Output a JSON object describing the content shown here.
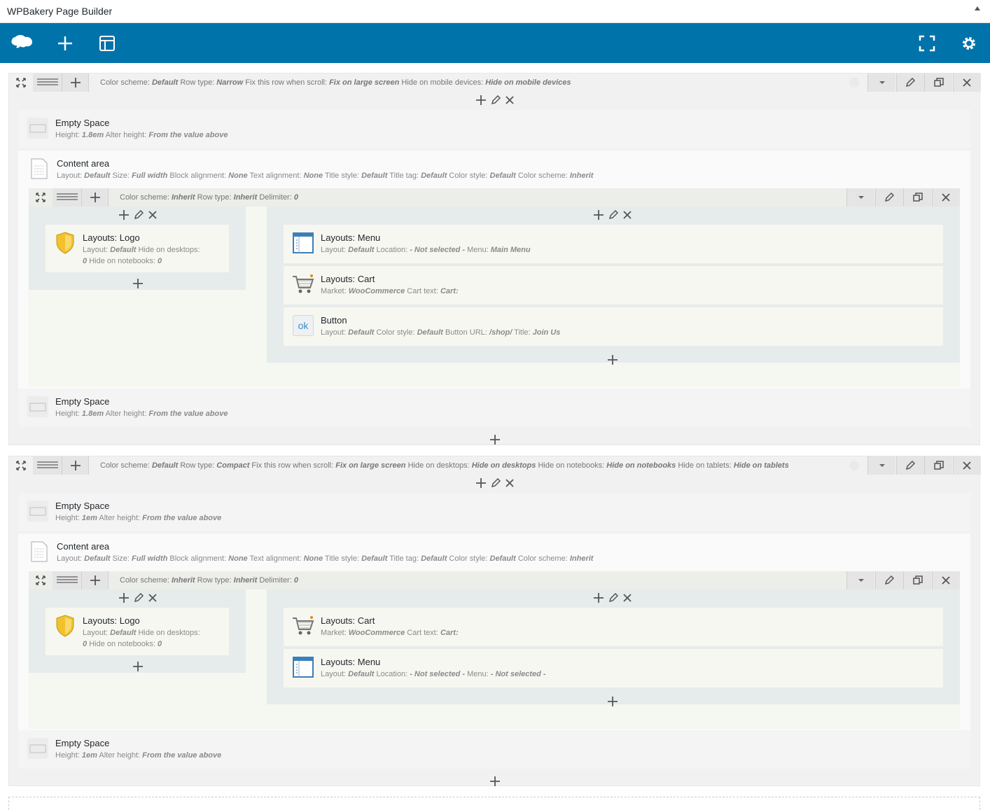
{
  "header": {
    "title": "WPBakery Page Builder"
  },
  "toolbar": {
    "logo_icon": "wpbakery-cloud-icon",
    "add_icon": "plus-icon",
    "templates_icon": "templates-icon",
    "fullscreen_icon": "fullscreen-icon",
    "settings_icon": "gear-icon"
  },
  "rows": [
    {
      "params": [
        {
          "k": "Color scheme:",
          "v": "Default"
        },
        {
          "k": "Row type:",
          "v": "Narrow"
        },
        {
          "k": "Fix this row when scroll:",
          "v": "Fix on large screen"
        },
        {
          "k": "Hide on mobile devices:",
          "v": "Hide on mobile devices"
        }
      ],
      "top_space": {
        "name": "Empty Space",
        "desc": [
          {
            "k": "Height:",
            "v": "1.8em"
          },
          {
            "k": "Alter height:",
            "v": "From the value above"
          }
        ]
      },
      "content": {
        "name": "Content area",
        "desc": [
          {
            "k": "Layout:",
            "v": "Default"
          },
          {
            "k": "Size:",
            "v": "Full width"
          },
          {
            "k": "Block alignment:",
            "v": "None"
          },
          {
            "k": "Text alignment:",
            "v": "None"
          },
          {
            "k": "Title style:",
            "v": "Default"
          },
          {
            "k": "Title tag:",
            "v": "Default"
          },
          {
            "k": "Color style:",
            "v": "Default"
          },
          {
            "k": "Color scheme:",
            "v": "Inherit"
          }
        ]
      },
      "inner_params": [
        {
          "k": "Color scheme:",
          "v": "Inherit"
        },
        {
          "k": "Row type:",
          "v": "Inherit"
        },
        {
          "k": "Delimiter:",
          "v": "0"
        }
      ],
      "logo": {
        "name": "Layouts: Logo",
        "line1": [
          {
            "k": "Layout:",
            "v": "Default"
          },
          {
            "k": "Hide on desktops:",
            "v": ""
          }
        ],
        "line2": [
          {
            "k": "",
            "v": "0"
          },
          {
            "k": "Hide on notebooks:",
            "v": "0"
          }
        ]
      },
      "right": [
        {
          "type": "menu",
          "name": "Layouts: Menu",
          "desc": [
            {
              "k": "Layout:",
              "v": "Default"
            },
            {
              "k": "Location:",
              "v": "- Not selected -"
            },
            {
              "k": "Menu:",
              "v": "Main Menu"
            }
          ]
        },
        {
          "type": "cart",
          "name": "Layouts: Cart",
          "desc": [
            {
              "k": "Market:",
              "v": "WooCommerce"
            },
            {
              "k": "Cart text:",
              "v": "Cart:"
            }
          ]
        },
        {
          "type": "button",
          "name": "Button",
          "desc": [
            {
              "k": "Layout:",
              "v": "Default"
            },
            {
              "k": "Color style:",
              "v": "Default"
            },
            {
              "k": "Button URL:",
              "v": "/shop/"
            },
            {
              "k": "Title:",
              "v": "Join Us"
            }
          ]
        }
      ],
      "bottom_space": {
        "name": "Empty Space",
        "desc": [
          {
            "k": "Height:",
            "v": "1.8em"
          },
          {
            "k": "Alter height:",
            "v": "From the value above"
          }
        ]
      }
    },
    {
      "params": [
        {
          "k": "Color scheme:",
          "v": "Default"
        },
        {
          "k": "Row type:",
          "v": "Compact"
        },
        {
          "k": "Fix this row when scroll:",
          "v": "Fix on large screen"
        },
        {
          "k": "Hide on desktops:",
          "v": "Hide on desktops"
        },
        {
          "k": "Hide on notebooks:",
          "v": "Hide on notebooks"
        },
        {
          "k": "Hide on tablets:",
          "v": "Hide on tablets"
        }
      ],
      "top_space": {
        "name": "Empty Space",
        "desc": [
          {
            "k": "Height:",
            "v": "1em"
          },
          {
            "k": "Alter height:",
            "v": "From the value above"
          }
        ]
      },
      "content": {
        "name": "Content area",
        "desc": [
          {
            "k": "Layout:",
            "v": "Default"
          },
          {
            "k": "Size:",
            "v": "Full width"
          },
          {
            "k": "Block alignment:",
            "v": "None"
          },
          {
            "k": "Text alignment:",
            "v": "None"
          },
          {
            "k": "Title style:",
            "v": "Default"
          },
          {
            "k": "Title tag:",
            "v": "Default"
          },
          {
            "k": "Color style:",
            "v": "Default"
          },
          {
            "k": "Color scheme:",
            "v": "Inherit"
          }
        ]
      },
      "inner_params": [
        {
          "k": "Color scheme:",
          "v": "Inherit"
        },
        {
          "k": "Row type:",
          "v": "Inherit"
        },
        {
          "k": "Delimiter:",
          "v": "0"
        }
      ],
      "logo": {
        "name": "Layouts: Logo",
        "line1": [
          {
            "k": "Layout:",
            "v": "Default"
          },
          {
            "k": "Hide on desktops:",
            "v": ""
          }
        ],
        "line2": [
          {
            "k": "",
            "v": "0"
          },
          {
            "k": "Hide on notebooks:",
            "v": "0"
          }
        ]
      },
      "right": [
        {
          "type": "cart",
          "name": "Layouts: Cart",
          "desc": [
            {
              "k": "Market:",
              "v": "WooCommerce"
            },
            {
              "k": "Cart text:",
              "v": "Cart:"
            }
          ]
        },
        {
          "type": "menu",
          "name": "Layouts: Menu",
          "desc": [
            {
              "k": "Layout:",
              "v": "Default"
            },
            {
              "k": "Location:",
              "v": "- Not selected -"
            },
            {
              "k": "Menu:",
              "v": "- Not selected -"
            }
          ]
        }
      ],
      "bottom_space": {
        "name": "Empty Space",
        "desc": [
          {
            "k": "Height:",
            "v": "1em"
          },
          {
            "k": "Alter height:",
            "v": "From the value above"
          }
        ]
      }
    }
  ],
  "button_icon_text": "ok",
  "colors": {
    "accent": "#0073aa"
  }
}
